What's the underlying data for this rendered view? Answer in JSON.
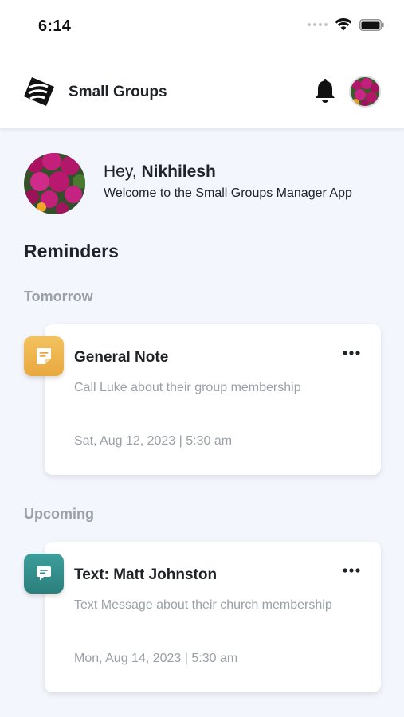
{
  "status_bar": {
    "time": "6:14"
  },
  "header": {
    "app_title": "Small Groups"
  },
  "greeting": {
    "prefix": "Hey,",
    "name": "Nikhilesh",
    "subtitle": "Welcome to the Small Groups Manager App"
  },
  "reminders": {
    "title": "Reminders",
    "groups": [
      {
        "label": "Tomorrow",
        "items": [
          {
            "icon": "note-icon",
            "color": "#eab14b",
            "title": "General Note",
            "description": "Call Luke about their group membership",
            "datetime": "Sat, Aug 12, 2023 | 5:30 am"
          }
        ]
      },
      {
        "label": "Upcoming",
        "items": [
          {
            "icon": "message-icon",
            "color": "#33908d",
            "title": "Text: Matt Johnston",
            "description": "Text Message about their church membership",
            "datetime": "Mon, Aug 14, 2023 | 5:30 am"
          }
        ]
      }
    ]
  }
}
